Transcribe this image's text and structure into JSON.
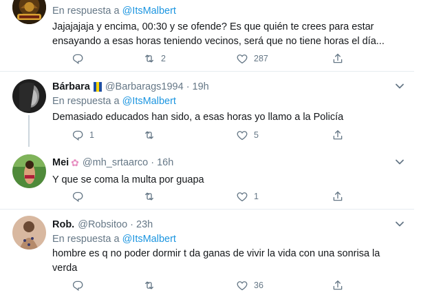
{
  "reply_prefix": "En respuesta a",
  "tweets": [
    {
      "mention": "@ItsMalbert",
      "text_lines": [
        "Jajajajaja y encima, 00:30 y se ofende? Es que quién te crees para estar",
        "ensayando a esas horas teniendo vecinos, será que no tiene horas el día..."
      ],
      "reply_count": "",
      "retweet_count": "2",
      "like_count": "287"
    },
    {
      "name": "Bárbara",
      "handle": "@Barbarags1994",
      "time": "19h",
      "mention": "@ItsMalbert",
      "text": "Demasiado educados han sido, a esas horas yo llamo a la Policía",
      "reply_count": "1",
      "retweet_count": "",
      "like_count": "5"
    },
    {
      "name": "Mei",
      "handle": "@mh_srtaarco",
      "time": "16h",
      "text": "Y que se coma la multa por guapa",
      "reply_count": "",
      "retweet_count": "",
      "like_count": "1"
    },
    {
      "name": "Rob.",
      "handle": "@Robsitoo",
      "time": "23h",
      "mention": "@ItsMalbert",
      "text_lines": [
        "hombre es q no poder dormir t da ganas de vivir la vida con una sonrisa la",
        "verda"
      ],
      "reply_count": "",
      "retweet_count": "",
      "like_count": "36"
    }
  ],
  "colors": {
    "text": "#14171a",
    "muted": "#657786",
    "link": "#1b95e0",
    "separator": "#e6ecf0"
  },
  "icons": [
    "reply-icon",
    "retweet-icon",
    "like-icon",
    "share-icon",
    "chevron-down-icon"
  ]
}
